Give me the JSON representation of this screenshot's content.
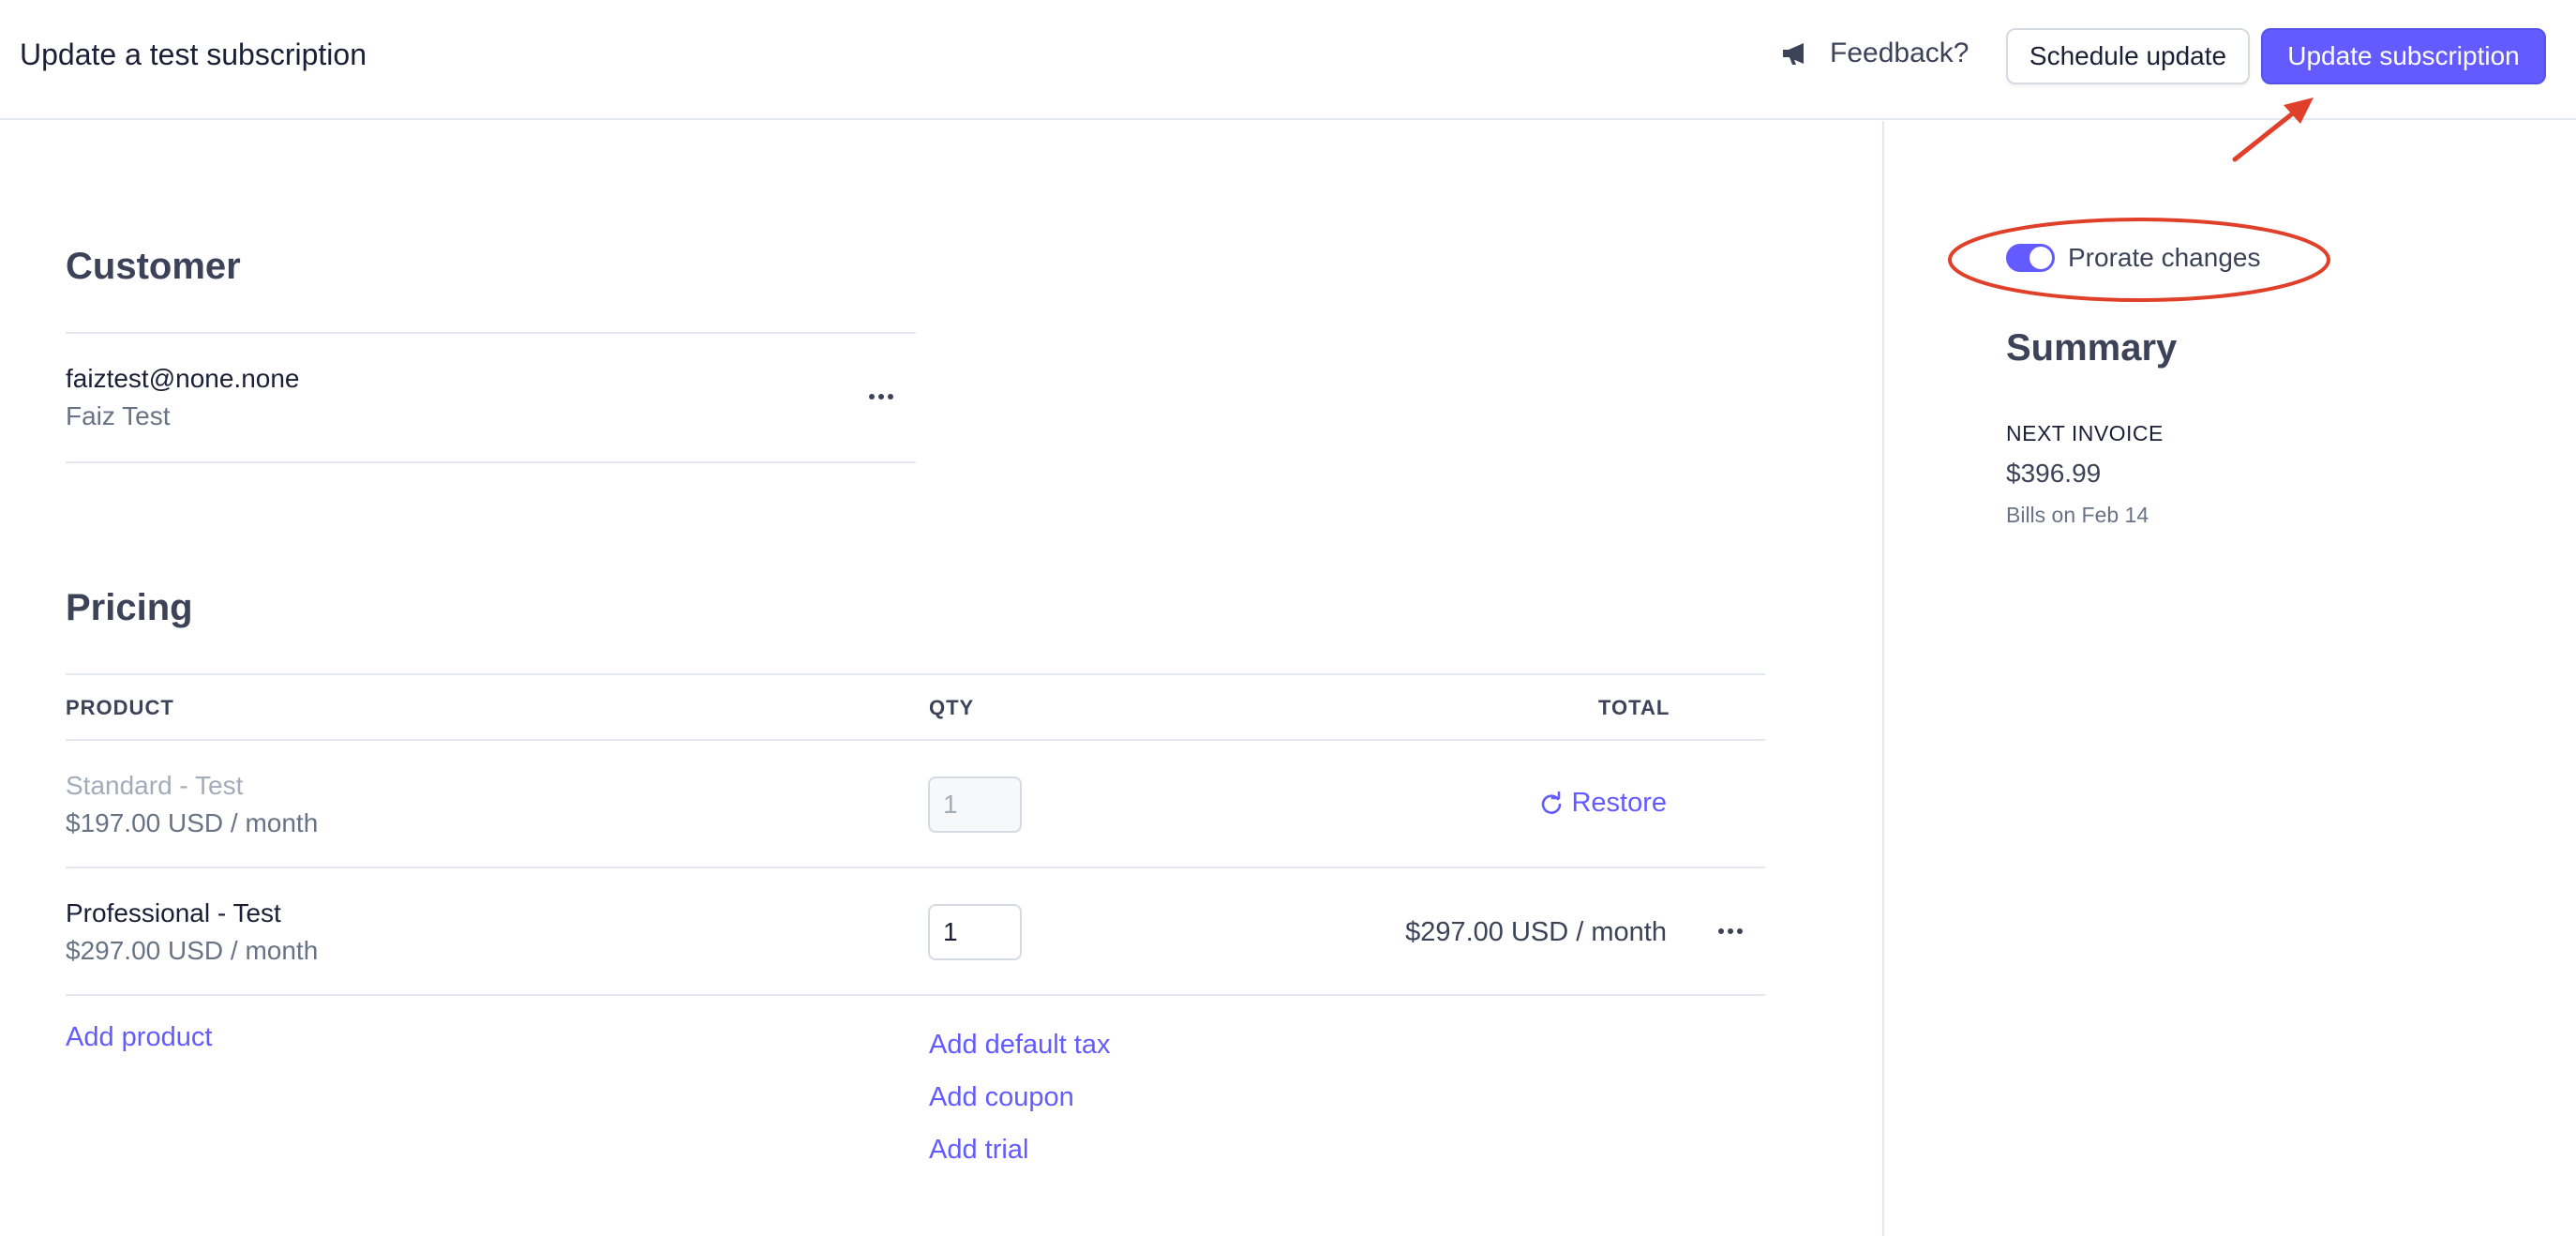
{
  "header": {
    "title": "Update a test subscription",
    "feedback_label": "Feedback?",
    "schedule_button": "Schedule update",
    "update_button": "Update subscription"
  },
  "customer": {
    "section_title": "Customer",
    "email": "faiztest@none.none",
    "name": "Faiz Test"
  },
  "pricing": {
    "section_title": "Pricing",
    "columns": {
      "product": "PRODUCT",
      "qty": "QTY",
      "total": "TOTAL"
    },
    "items": [
      {
        "name": "Standard - Test",
        "price": "$197.00 USD / month",
        "qty": "1",
        "action": "Restore",
        "removed": true
      },
      {
        "name": "Professional - Test",
        "price": "$297.00 USD / month",
        "qty": "1",
        "total": "$297.00 USD / month",
        "removed": false
      }
    ],
    "add_product": "Add product",
    "add_default_tax": "Add default tax",
    "add_coupon": "Add coupon",
    "add_trial": "Add trial"
  },
  "sidebar": {
    "prorate_label": "Prorate changes",
    "prorate_enabled": true,
    "summary_title": "Summary",
    "next_invoice_label": "NEXT INVOICE",
    "next_invoice_amount": "$396.99",
    "bills_on": "Bills on Feb 14"
  },
  "colors": {
    "accent": "#635bff",
    "annotation": "#e0402a",
    "text_primary": "#1a1f36",
    "text_secondary": "#697386"
  }
}
